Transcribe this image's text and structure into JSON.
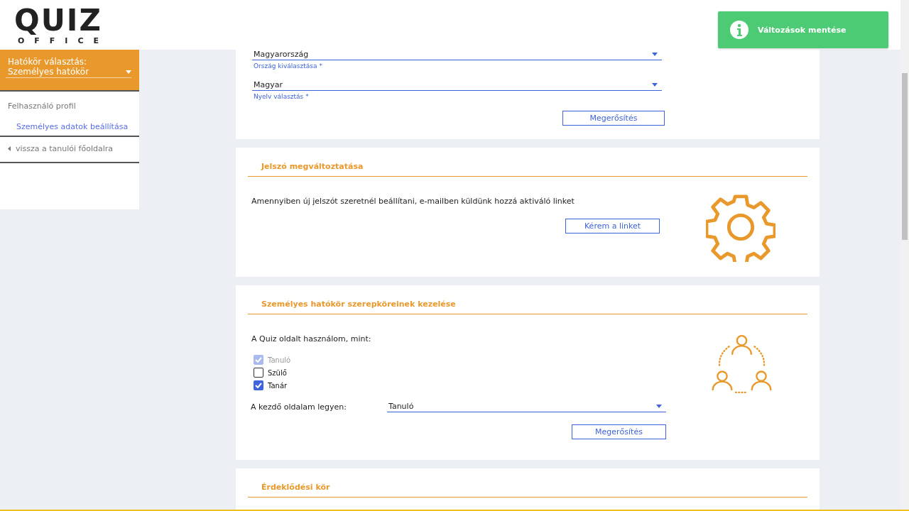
{
  "logo": {
    "word": "QUIZ",
    "sub": "OFFICE"
  },
  "toast": {
    "text": "Változások mentése"
  },
  "sidebar": {
    "scope_label": "Hatókör választás:",
    "scope_value": "Személyes hatókör",
    "section": "Felhasználó profil",
    "items": [
      {
        "label": "Személyes adatok beállítása",
        "selected": true
      }
    ],
    "back": "vissza a tanulói főoldalra"
  },
  "cards": [
    {
      "kind": "fields",
      "fields": [
        {
          "value": "Magyarország",
          "label": "Ország kiválasztása *"
        },
        {
          "value": "Magyar",
          "label": "Nyelv választás *"
        }
      ],
      "button": "Megerősítés"
    },
    {
      "kind": "password",
      "title": "Jelszó megváltoztatása",
      "text": "Amennyiben új jelszót szeretnél beállítani, e-mailben küldünk hozzá aktiváló linket",
      "button": "Kérem a linket"
    },
    {
      "kind": "roles",
      "title": "Személyes hatókör szerepköreinek kezelése",
      "intro": "A Quiz oldalt használom, mint:",
      "roles": [
        {
          "label": "Tanuló",
          "checked": true,
          "disabled": true
        },
        {
          "label": "Szülő",
          "checked": false,
          "disabled": false
        },
        {
          "label": "Tanár",
          "checked": true,
          "disabled": false
        }
      ],
      "start_label": "A kezdő oldalam legyen:",
      "start_value": "Tanuló",
      "button": "Megerősítés"
    },
    {
      "kind": "interests",
      "title": "Érdeklődési kör"
    }
  ]
}
